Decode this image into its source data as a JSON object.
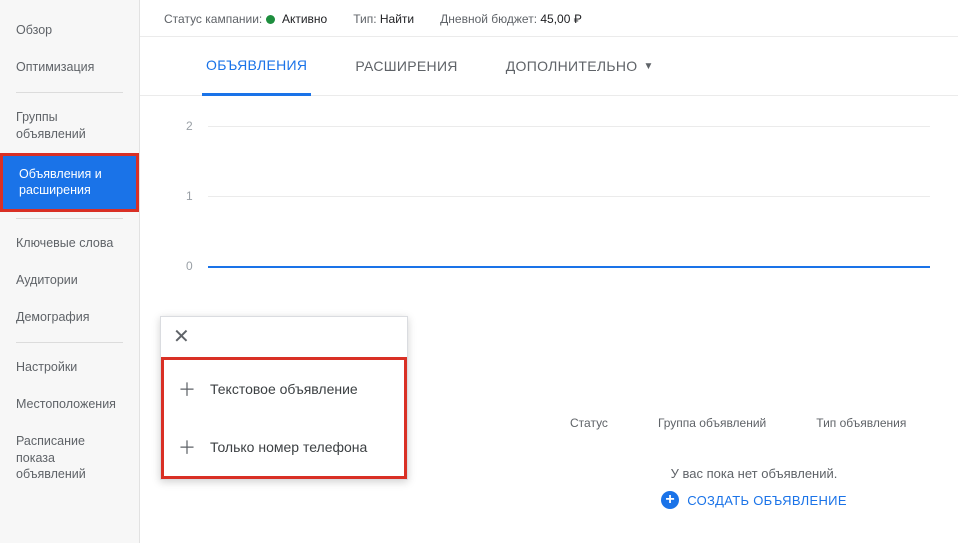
{
  "sidebar": {
    "items": [
      {
        "label": "Обзор"
      },
      {
        "label": "Оптимизация"
      },
      {
        "label": "Группы объявлений"
      },
      {
        "label": "Объявления и расширения"
      },
      {
        "label": "Ключевые слова"
      },
      {
        "label": "Аудитории"
      },
      {
        "label": "Демография"
      },
      {
        "label": "Настройки"
      },
      {
        "label": "Местоположения"
      },
      {
        "label": "Расписание показа объявлений"
      }
    ]
  },
  "header": {
    "status_label": "Статус кампании:",
    "status_value": "Активно",
    "type_label": "Тип:",
    "type_value": "Найти",
    "budget_label": "Дневной бюджет:",
    "budget_value": "45,00 ₽"
  },
  "tabs": {
    "ads": "ОБЪЯВЛЕНИЯ",
    "extensions": "РАСШИРЕНИЯ",
    "more": "ДОПОЛНИТЕЛЬНО"
  },
  "popup": {
    "text_ad": "Текстовое объявление",
    "call_only": "Только номер телефона"
  },
  "table": {
    "cols": {
      "status": "Статус",
      "group": "Группа объявлений",
      "type": "Тип объявления"
    }
  },
  "empty": {
    "text": "У вас пока нет объявлений.",
    "button": "СОЗДАТЬ ОБЪЯВЛЕНИЕ"
  },
  "chart_data": {
    "type": "line",
    "title": "",
    "xlabel": "",
    "ylabel": "",
    "ylim": [
      0,
      2
    ],
    "y_ticks": [
      "0",
      "1",
      "2"
    ],
    "series": [
      {
        "name": "",
        "values": []
      }
    ]
  }
}
